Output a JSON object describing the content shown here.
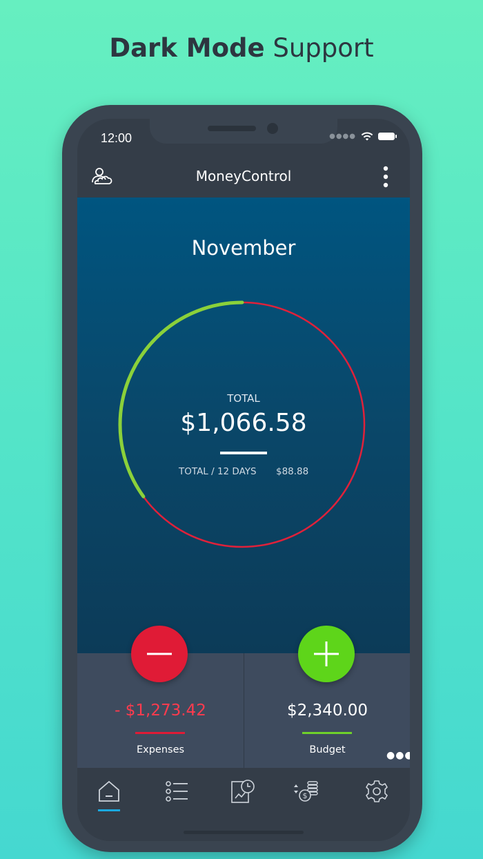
{
  "headline": {
    "bold": "Dark Mode",
    "light": "Support"
  },
  "status_bar": {
    "time": "12:00"
  },
  "app_bar": {
    "title": "MoneyControl"
  },
  "summary": {
    "month": "November",
    "total_label": "TOTAL",
    "total_value": "$1,066.58",
    "per_days_label": "TOTAL / 12 DAYS",
    "per_days_value": "$88.88",
    "ring": {
      "spent_fraction": 0.35,
      "spent_color": "#8bd13a",
      "remaining_color": "#e0213a"
    }
  },
  "expenses": {
    "amount": "- $1,273.42",
    "label": "Expenses",
    "color": "#ff3b4e"
  },
  "budget": {
    "amount": "$2,340.00",
    "label": "Budget",
    "color": "#ffffff"
  },
  "tabs": [
    {
      "icon": "home-icon",
      "active": true
    },
    {
      "icon": "list-icon",
      "active": false
    },
    {
      "icon": "history-icon",
      "active": false
    },
    {
      "icon": "currency-coins-icon",
      "active": false
    },
    {
      "icon": "settings-gear-icon",
      "active": false
    }
  ],
  "colors": {
    "background_top": "#66efc0",
    "accent_blue": "#1aa9e0",
    "minus_red": "#e01b36",
    "plus_green": "#5ed51a"
  }
}
